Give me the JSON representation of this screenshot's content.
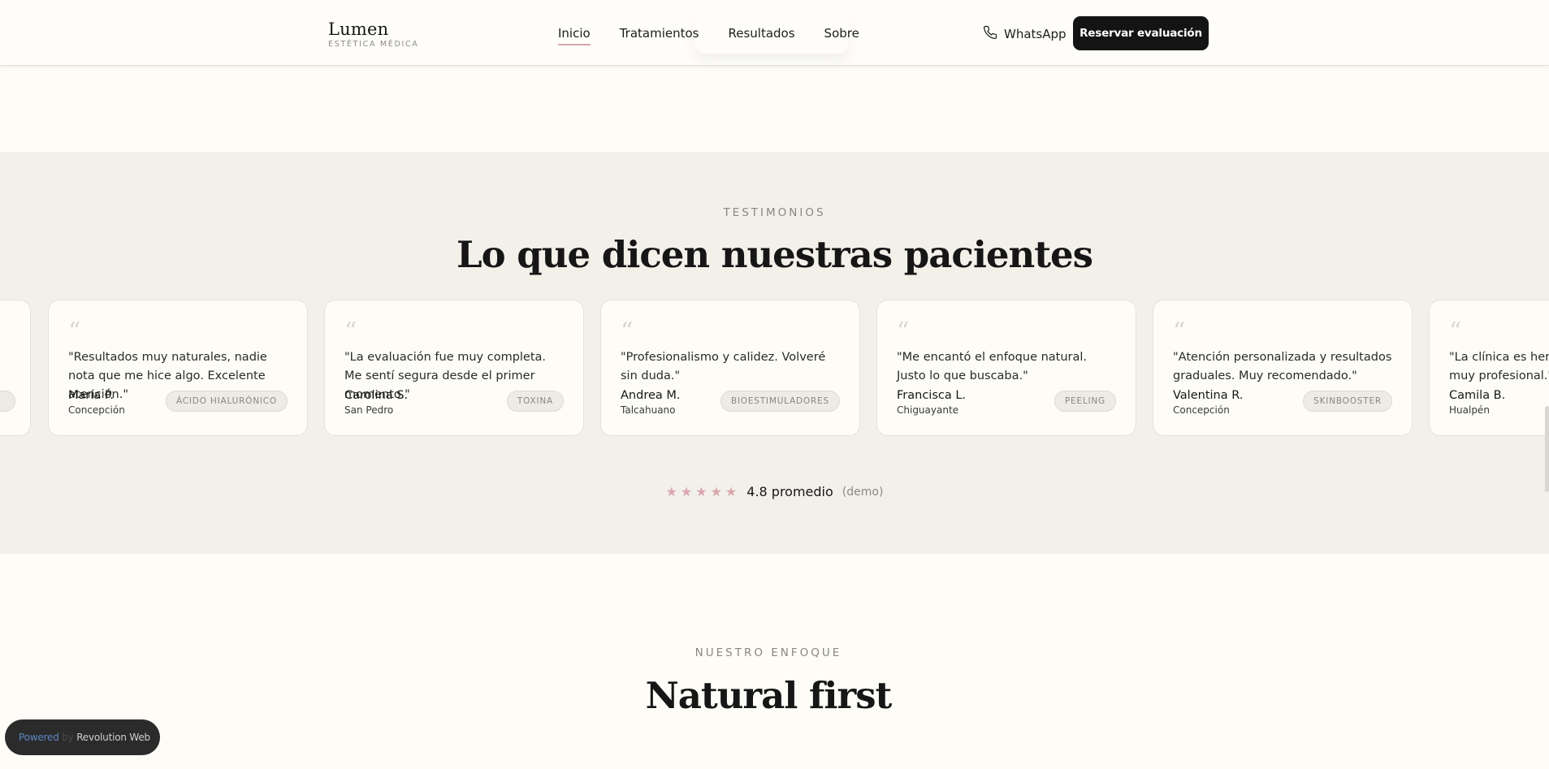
{
  "header": {
    "brand_name": "Lumen",
    "brand_sub": "ESTÉTICA MÉDICA",
    "nav": [
      {
        "label": "Inicio",
        "active": true
      },
      {
        "label": "Tratamientos",
        "active": false
      },
      {
        "label": "Resultados",
        "active": false
      },
      {
        "label": "Sobre",
        "active": false
      }
    ],
    "whatsapp_label": "WhatsApp",
    "cta_label": "Reservar evaluación"
  },
  "testimonials": {
    "eyebrow": "TESTIMONIOS",
    "title": "Lo que dicen nuestras pacientes",
    "quote_glyph": "“",
    "cards": [
      {
        "text": "\"Resultados muy naturales, nadie nota que me hice algo. Excelente atención.\"",
        "name": "María P.",
        "city": "Concepción",
        "tag": "ÁCIDO HIALURÓNICO"
      },
      {
        "text": "\"La evaluación fue muy completa. Me sentí segura desde el primer momento.\"",
        "name": "Carolina S.",
        "city": "San Pedro",
        "tag": "TOXINA"
      },
      {
        "text": "\"Profesionalismo y calidez. Volveré sin duda.\"",
        "name": "Andrea M.",
        "city": "Talcahuano",
        "tag": "BIOESTIMULADORES"
      },
      {
        "text": "\"Me encantó el enfoque natural. Justo lo que buscaba.\"",
        "name": "Francisca L.",
        "city": "Chiguayante",
        "tag": "PEELING"
      },
      {
        "text": "\"Atención personalizada y resultados graduales. Muy recomendado.\"",
        "name": "Valentina R.",
        "city": "Concepción",
        "tag": "SKINBOOSTER"
      },
      {
        "text": "\"La clínica es hermosa y el equipo muy profesional.\"",
        "name": "Camila B.",
        "city": "Hualpén",
        "tag": ""
      }
    ],
    "rating_stars": 5,
    "rating_value": "4.8 promedio",
    "rating_note": "(demo)"
  },
  "approach": {
    "eyebrow": "NUESTRO ENFOQUE",
    "title": "Natural first"
  },
  "badge": {
    "part1": "Powered",
    "part2": "by",
    "part3": "Revolution Web"
  },
  "colors": {
    "accent_pink": "#d7a5aa",
    "cta_bg": "#141414",
    "section_bg": "#f3f0ea",
    "page_bg": "#fdfcf7"
  }
}
